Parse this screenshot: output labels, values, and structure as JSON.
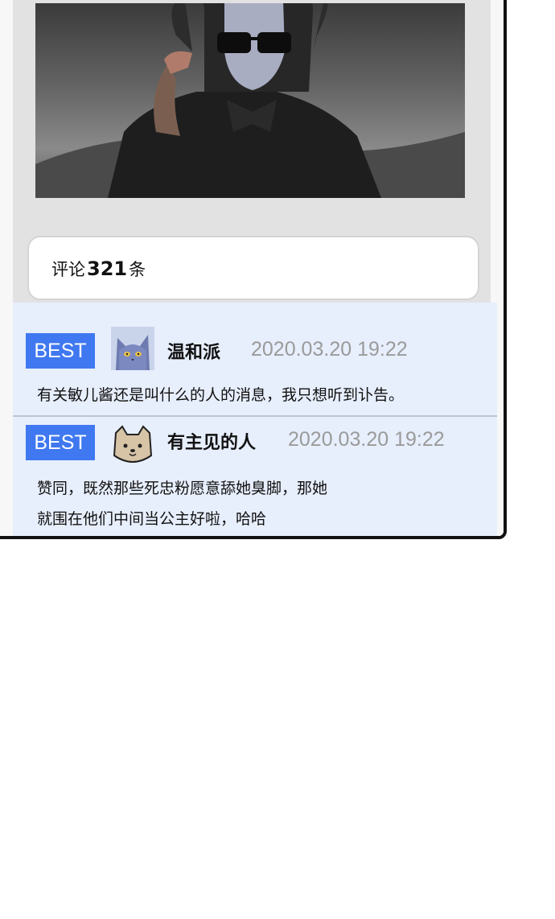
{
  "comment_count": {
    "prefix": "评论",
    "number": "321",
    "suffix": "条"
  },
  "comments": [
    {
      "badge": "BEST",
      "username": "温和派",
      "avatar": "blue-cat-avatar",
      "timestamp": "2020.03.20 19:22",
      "lines": [
        "有关敏儿酱还是叫什么的人的消息，我只想听到讣告。"
      ]
    },
    {
      "badge": "BEST",
      "username": "有主见的人",
      "avatar": "beige-cat-avatar",
      "timestamp": "2020.03.20 19:22",
      "lines": [
        "赞同，既然那些死忠粉愿意舔她臭脚，那她",
        "就围在他们中间当公主好啦，哈哈"
      ]
    }
  ],
  "colors": {
    "best_badge": "#3f78f0",
    "comments_bg": "#e7eefc",
    "timestamp": "#9a9a9a"
  }
}
